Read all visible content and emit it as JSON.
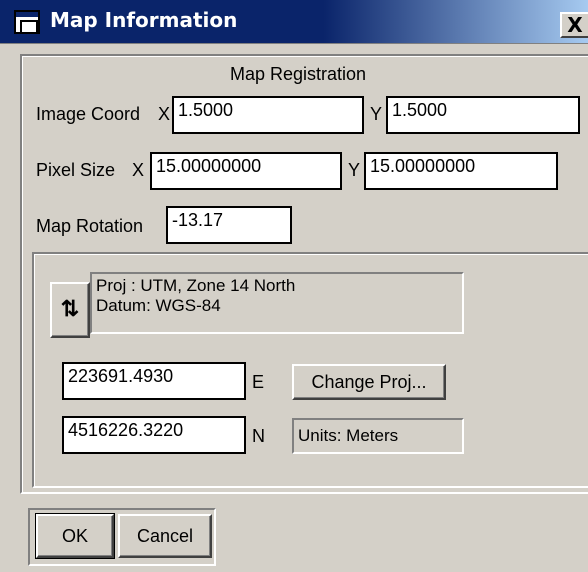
{
  "window": {
    "title": "Map Information",
    "close_glyph": "X"
  },
  "registration": {
    "heading": "Map Registration",
    "image_coord_label": "Image Coord",
    "x_label": "X",
    "y_label": "Y",
    "image_coord_x": "1.5000",
    "image_coord_y": "1.5000",
    "pixel_size_label": "Pixel Size",
    "pixel_size_x": "15.00000000",
    "pixel_size_y": "15.00000000",
    "map_rotation_label": "Map Rotation",
    "map_rotation": "-13.17"
  },
  "projection": {
    "toggle_glyph": "⇅",
    "proj_line": "Proj : UTM, Zone 14 North",
    "datum_line": "Datum: WGS-84",
    "easting": "223691.4930",
    "easting_label": "E",
    "northing": "4516226.3220",
    "northing_label": "N",
    "change_proj_label": "Change Proj...",
    "units": "Units: Meters"
  },
  "buttons": {
    "ok": "OK",
    "cancel": "Cancel"
  },
  "colors": {
    "titlebar": "#0a246a",
    "face": "#d4d0c8"
  }
}
